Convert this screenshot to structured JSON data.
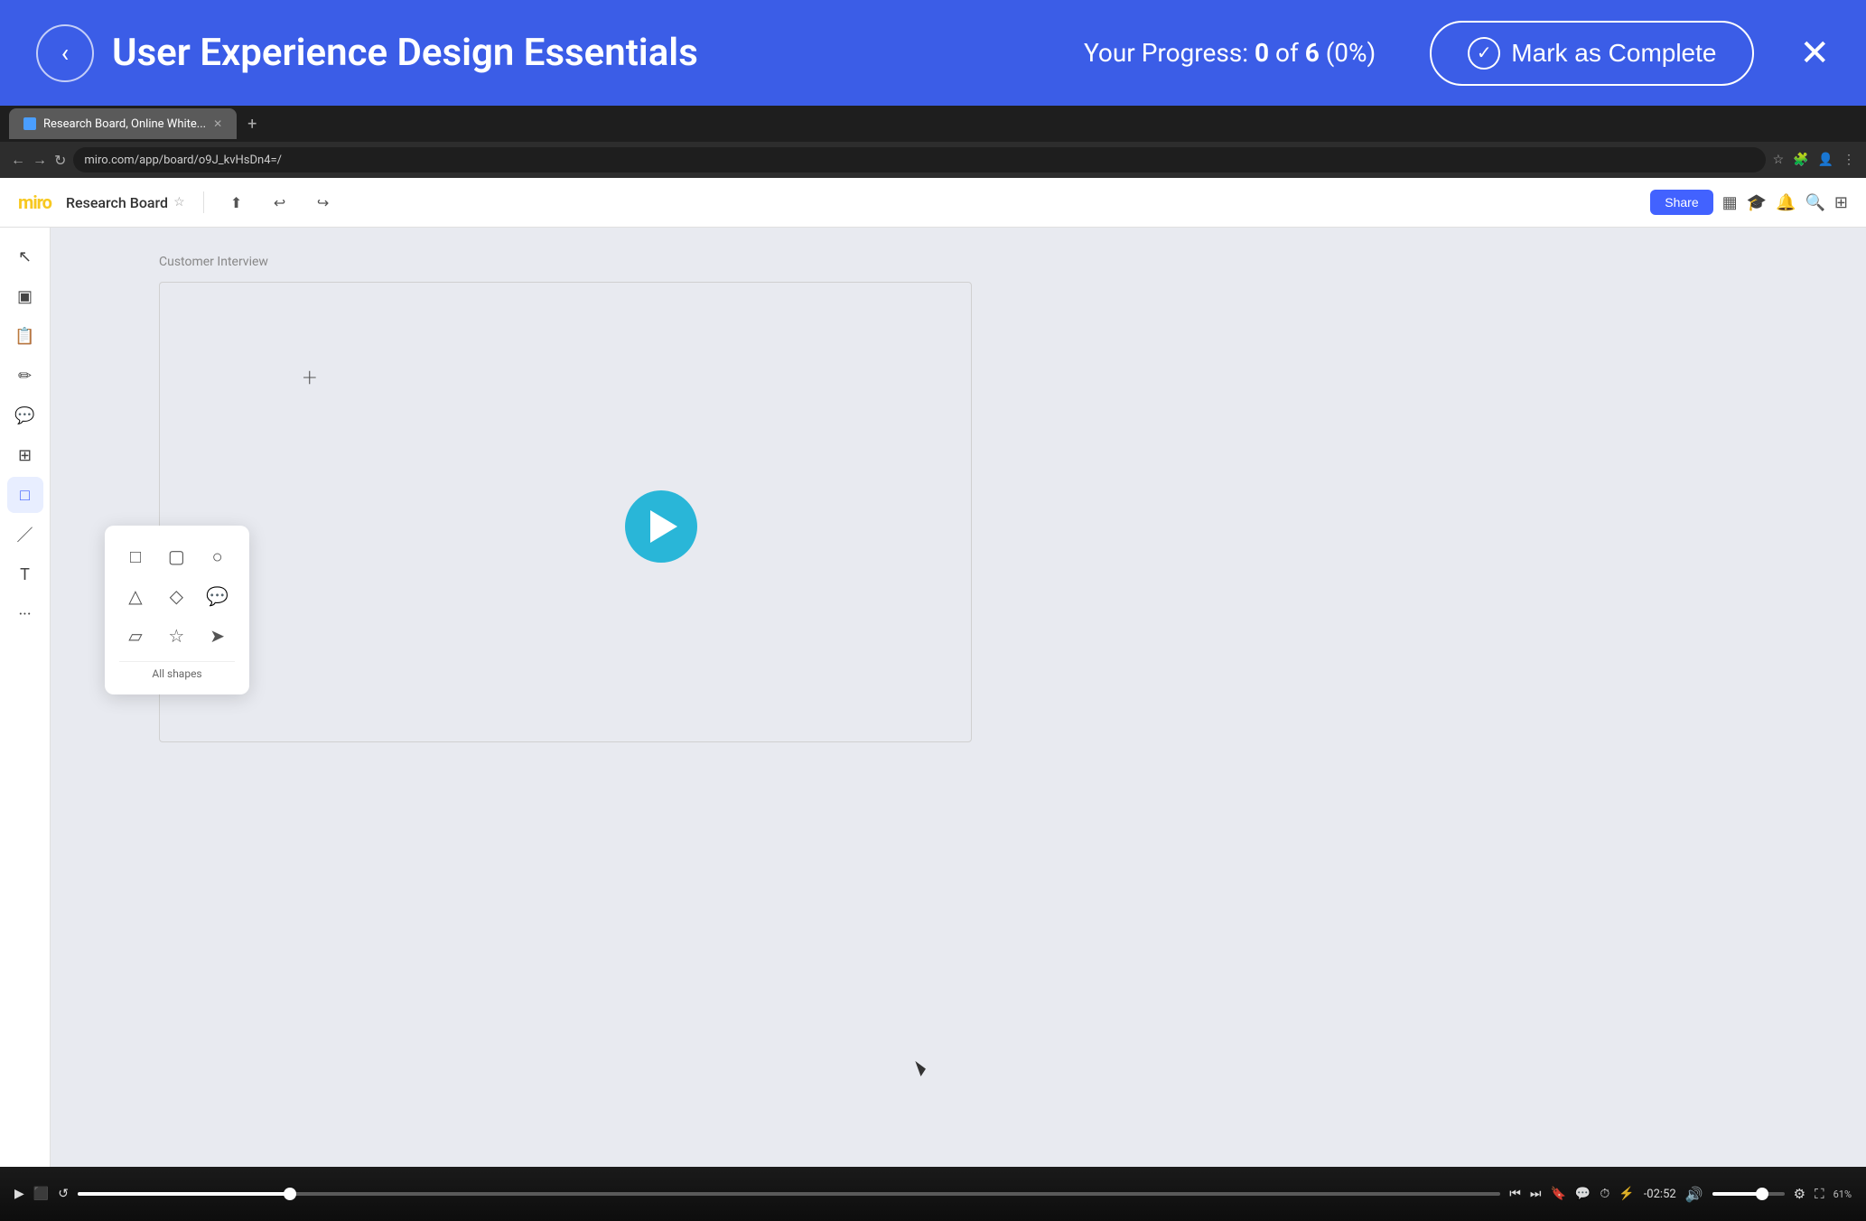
{
  "header": {
    "back_label": "‹",
    "course_title": "User Experience Design Essentials",
    "progress_label": "Your Progress:",
    "progress_current": "0",
    "progress_total": "6",
    "progress_pct": "(0%)",
    "mark_complete_label": "Mark as Complete",
    "close_label": "✕"
  },
  "browser": {
    "tab_title": "Research Board, Online White...",
    "tab_favicon": "🔵",
    "url": "miro.com/app/board/o9J_kvHsDn4=/",
    "new_tab_label": "+"
  },
  "miro": {
    "logo": "miro",
    "board_name": "Research Board",
    "share_label": "Share",
    "video_label": "Customer Interview",
    "all_shapes_label": "All shapes",
    "time_remaining": "-02:52",
    "zoom_label": "61%"
  }
}
